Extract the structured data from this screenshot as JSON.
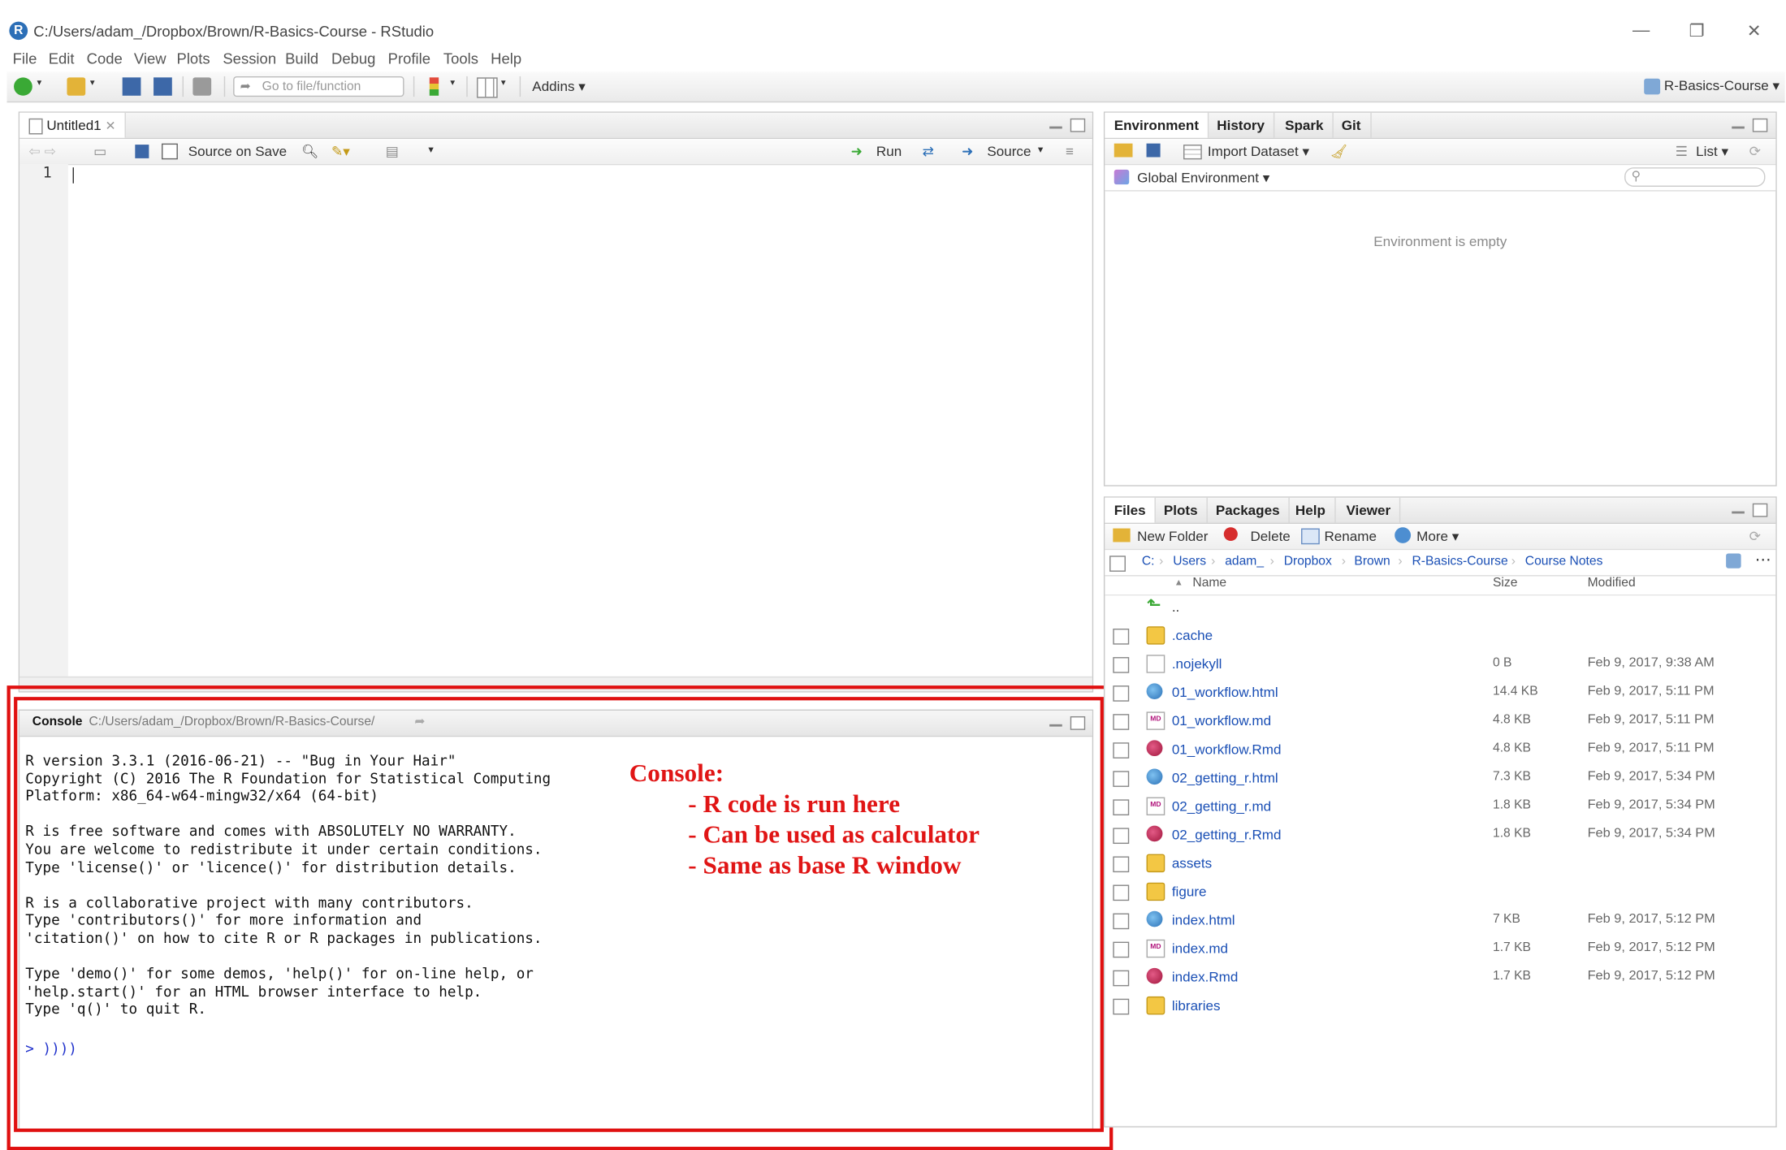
{
  "window": {
    "title": "C:/Users/adam_/Dropbox/Brown/R-Basics-Course - RStudio",
    "controls": [
      "—",
      "❐",
      "✕"
    ]
  },
  "menu": [
    "File",
    "Edit",
    "Code",
    "View",
    "Plots",
    "Session",
    "Build",
    "Debug",
    "Profile",
    "Tools",
    "Help"
  ],
  "toolbar": {
    "goto_placeholder": "Go to file/function",
    "addins_label": "Addins",
    "project_label": "R-Basics-Course"
  },
  "editor": {
    "tab_label": "Untitled1",
    "source_on_save": "Source on Save",
    "run_label": "Run",
    "source_label": "Source",
    "line_number": "1"
  },
  "console": {
    "tab_label": "Console",
    "path": "C:/Users/adam_/Dropbox/Brown/R-Basics-Course/",
    "output": "R version 3.3.1 (2016-06-21) -- \"Bug in Your Hair\"\nCopyright (C) 2016 The R Foundation for Statistical Computing\nPlatform: x86_64-w64-mingw32/x64 (64-bit)\n\nR is free software and comes with ABSOLUTELY NO WARRANTY.\nYou are welcome to redistribute it under certain conditions.\nType 'license()' or 'licence()' for distribution details.\n\nR is a collaborative project with many contributors.\nType 'contributors()' for more information and\n'citation()' on how to cite R or R packages in publications.\n\nType 'demo()' for some demos, 'help()' for on-line help, or\n'help.start()' for an HTML browser interface to help.\nType 'q()' to quit R.",
    "prompt": "> ))))"
  },
  "annotation": {
    "title": "Console:",
    "lines": [
      "- R code is run here",
      "- Can be used as calculator",
      "- Same as base R window"
    ]
  },
  "environment": {
    "tabs": [
      "Environment",
      "History",
      "Spark",
      "Git"
    ],
    "import_dataset": "Import Dataset",
    "list_label": "List",
    "global_env": "Global Environment",
    "empty_message": "Environment is empty"
  },
  "files": {
    "tabs": [
      "Files",
      "Plots",
      "Packages",
      "Help",
      "Viewer"
    ],
    "actions": {
      "new_folder": "New Folder",
      "delete": "Delete",
      "rename": "Rename",
      "more": "More"
    },
    "breadcrumb": [
      "C:",
      "Users",
      "adam_",
      "Dropbox",
      "Brown",
      "R-Basics-Course",
      "Course Notes"
    ],
    "columns": {
      "name": "Name",
      "size": "Size",
      "modified": "Modified"
    },
    "up_label": "..",
    "rows": [
      {
        "name": ".cache",
        "icon": "folder-icon",
        "size": "",
        "modified": ""
      },
      {
        "name": ".nojekyll",
        "icon": "file-icon",
        "size": "0 B",
        "modified": "Feb 9, 2017, 9:38 AM"
      },
      {
        "name": "01_workflow.html",
        "icon": "html-icon",
        "size": "14.4 KB",
        "modified": "Feb 9, 2017, 5:11 PM"
      },
      {
        "name": "01_workflow.md",
        "icon": "md-icon",
        "size": "4.8 KB",
        "modified": "Feb 9, 2017, 5:11 PM"
      },
      {
        "name": "01_workflow.Rmd",
        "icon": "rmd-icon",
        "size": "4.8 KB",
        "modified": "Feb 9, 2017, 5:11 PM"
      },
      {
        "name": "02_getting_r.html",
        "icon": "html-icon",
        "size": "7.3 KB",
        "modified": "Feb 9, 2017, 5:34 PM"
      },
      {
        "name": "02_getting_r.md",
        "icon": "md-icon",
        "size": "1.8 KB",
        "modified": "Feb 9, 2017, 5:34 PM"
      },
      {
        "name": "02_getting_r.Rmd",
        "icon": "rmd-icon",
        "size": "1.8 KB",
        "modified": "Feb 9, 2017, 5:34 PM"
      },
      {
        "name": "assets",
        "icon": "folder-icon",
        "size": "",
        "modified": ""
      },
      {
        "name": "figure",
        "icon": "folder-icon",
        "size": "",
        "modified": ""
      },
      {
        "name": "index.html",
        "icon": "html-icon",
        "size": "7 KB",
        "modified": "Feb 9, 2017, 5:12 PM"
      },
      {
        "name": "index.md",
        "icon": "md-icon",
        "size": "1.7 KB",
        "modified": "Feb 9, 2017, 5:12 PM"
      },
      {
        "name": "index.Rmd",
        "icon": "rmd-icon",
        "size": "1.7 KB",
        "modified": "Feb 9, 2017, 5:12 PM"
      },
      {
        "name": "libraries",
        "icon": "folder-icon",
        "size": "",
        "modified": ""
      }
    ]
  },
  "colors": {
    "annotation_red": "#e01010",
    "link_blue": "#1a4fb5"
  }
}
